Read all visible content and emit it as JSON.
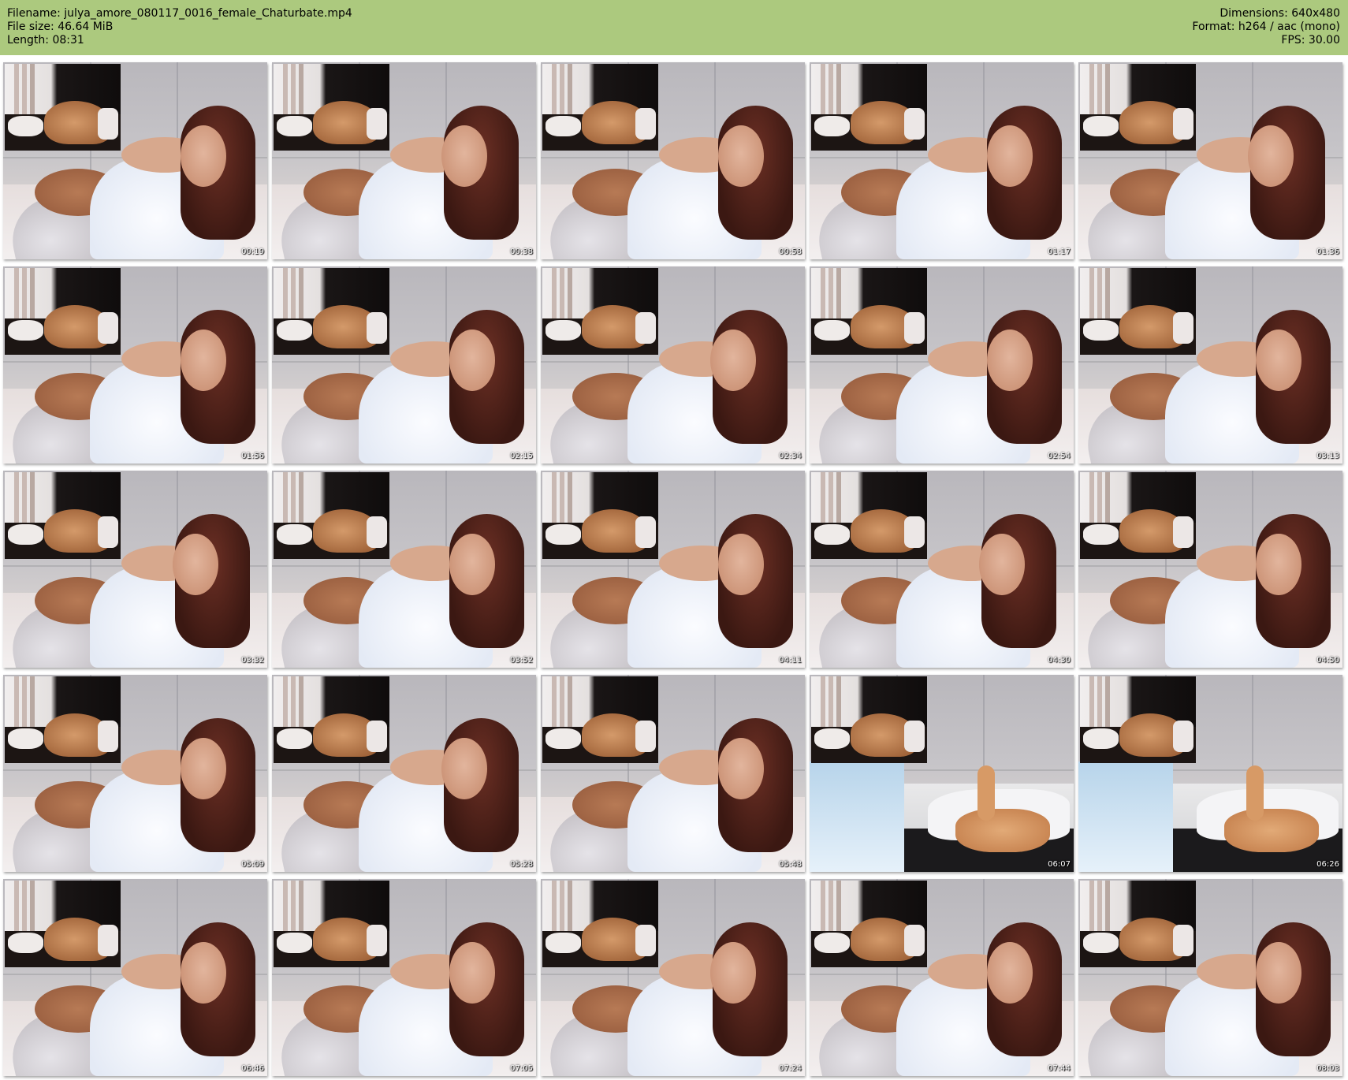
{
  "header": {
    "filename_line": "Filename: julya_amore_080117_0016_female_Chaturbate.mp4",
    "filesize_line": "File size: 46.64 MiB",
    "length_line": "Length: 08:31",
    "dimensions_line": "Dimensions: 640x480",
    "format_line": "Format: h264 / aac (mono)",
    "fps_line": "FPS: 30.00"
  },
  "colors": {
    "header_background": "#acc97e",
    "page_background": "#ffffff",
    "timestamp_text": "#ffffff"
  },
  "thumbnails": [
    {
      "time": "00:19",
      "scene": "bed"
    },
    {
      "time": "00:38",
      "scene": "bed"
    },
    {
      "time": "00:58",
      "scene": "bed"
    },
    {
      "time": "01:17",
      "scene": "bed"
    },
    {
      "time": "01:36",
      "scene": "bed"
    },
    {
      "time": "01:56",
      "scene": "bed"
    },
    {
      "time": "02:15",
      "scene": "bed"
    },
    {
      "time": "02:34",
      "scene": "bed"
    },
    {
      "time": "02:54",
      "scene": "bed"
    },
    {
      "time": "03:13",
      "scene": "bed"
    },
    {
      "time": "03:32",
      "scene": "bed"
    },
    {
      "time": "03:52",
      "scene": "bed"
    },
    {
      "time": "04:11",
      "scene": "bed"
    },
    {
      "time": "04:30",
      "scene": "bed"
    },
    {
      "time": "04:50",
      "scene": "bed"
    },
    {
      "time": "05:09",
      "scene": "bed"
    },
    {
      "time": "05:28",
      "scene": "bed"
    },
    {
      "time": "05:48",
      "scene": "bed"
    },
    {
      "time": "06:07",
      "scene": "toy"
    },
    {
      "time": "06:26",
      "scene": "toy"
    },
    {
      "time": "06:46",
      "scene": "bed"
    },
    {
      "time": "07:05",
      "scene": "bed"
    },
    {
      "time": "07:24",
      "scene": "bed"
    },
    {
      "time": "07:44",
      "scene": "bed"
    },
    {
      "time": "08:03",
      "scene": "bed"
    }
  ]
}
